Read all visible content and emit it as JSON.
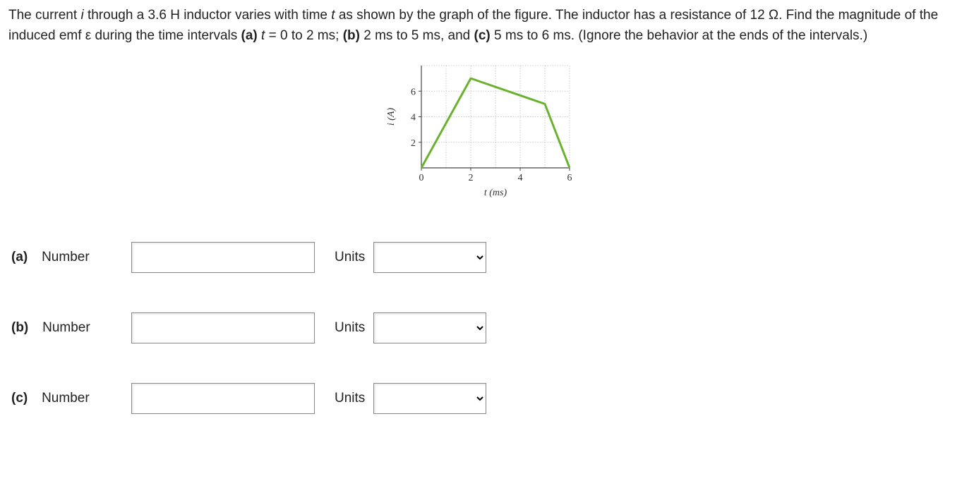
{
  "problem": {
    "p1a": "The current ",
    "p1b": "i",
    "p1c": " through a 3.6 H inductor varies with time ",
    "p1d": "t",
    "p1e": " as shown by the graph of the figure. The inductor has a resistance of 12 Ω. Find the magnitude of the induced emf ε during the time intervals ",
    "p1f": "(a)",
    "p1g": " ",
    "p1h": "t",
    "p1i": " = 0 to 2 ms; ",
    "p1j": "(b)",
    "p1k": " 2 ms to 5 ms, and ",
    "p1l": "(c)",
    "p1m": " 5 ms to 6 ms. (Ignore the behavior at the ends of the intervals.)"
  },
  "chart_data": {
    "type": "line",
    "xlabel": "t (ms)",
    "ylabel": "i (A)",
    "x_ticks": [
      0,
      2,
      4,
      6
    ],
    "y_ticks": [
      2,
      4,
      6
    ],
    "xlim": [
      0,
      6
    ],
    "ylim": [
      0,
      8
    ],
    "series": [
      {
        "name": "current",
        "points": [
          {
            "x": 0,
            "y": 0
          },
          {
            "x": 2,
            "y": 7
          },
          {
            "x": 5,
            "y": 5
          },
          {
            "x": 6,
            "y": 0
          }
        ]
      }
    ]
  },
  "answers": {
    "a": {
      "label_bold": "(a)",
      "label_rest": "Number",
      "units_label": "Units",
      "value": "",
      "units": ""
    },
    "b": {
      "label_bold": "(b)",
      "label_rest": "Number",
      "units_label": "Units",
      "value": "",
      "units": ""
    },
    "c": {
      "label_bold": "(c)",
      "label_rest": "Number",
      "units_label": "Units",
      "value": "",
      "units": ""
    }
  }
}
